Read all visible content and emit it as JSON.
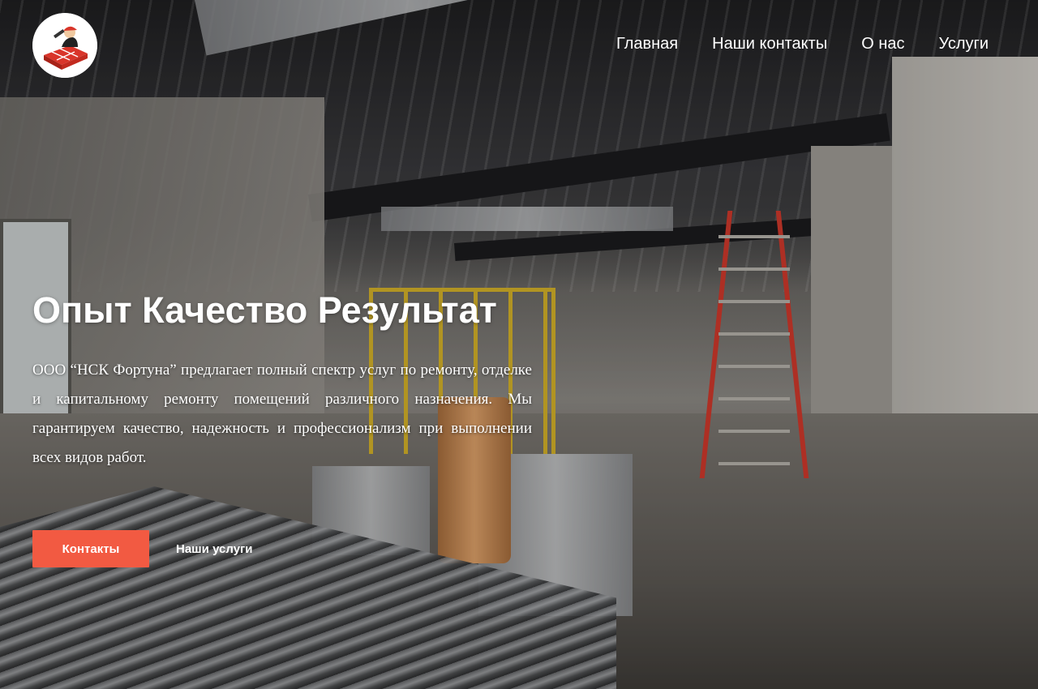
{
  "header": {
    "logo_icon": "builder-helmet-bricks-logo",
    "nav": [
      {
        "label": "Главная"
      },
      {
        "label": "Наши контакты"
      },
      {
        "label": "О нас"
      },
      {
        "label": "Услуги"
      }
    ]
  },
  "hero": {
    "title": "Опыт Качество Результат",
    "description": "ООО “НСК Фортуна”  предлагает полный спектр услуг по ремонту, отделке и капитальному ремонту помещений различного назначения. Мы гарантируем качество, надежность и профессионализм при выполнении всех видов работ.",
    "primary_button": "Контакты",
    "secondary_button": "Наши услуги"
  },
  "colors": {
    "accent": "#f25a42",
    "text": "#ffffff"
  }
}
